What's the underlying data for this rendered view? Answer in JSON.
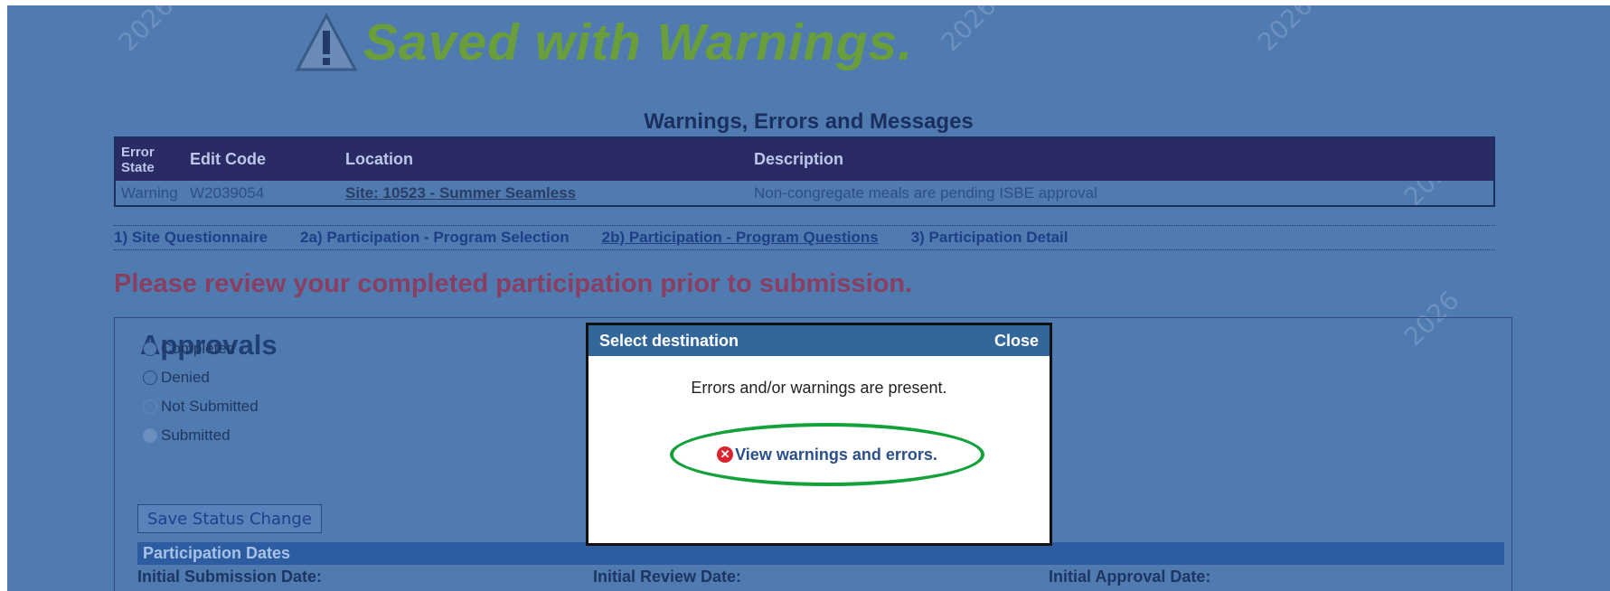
{
  "banner": {
    "text": "Saved with Warnings."
  },
  "messages": {
    "title": "Warnings, Errors and Messages",
    "columns": {
      "state": "Error State",
      "edit_code": "Edit Code",
      "location": "Location",
      "description": "Description"
    },
    "rows": [
      {
        "state": "Warning",
        "edit_code": "W2039054",
        "location": "Site: 10523 - Summer Seamless",
        "description": "Non-congregate meals are pending ISBE approval"
      }
    ]
  },
  "tabs": [
    {
      "label": "1) Site Questionnaire"
    },
    {
      "label": "2a) Participation - Program Selection"
    },
    {
      "label": "2b) Participation - Program Questions"
    },
    {
      "label": "3) Participation Detail"
    }
  ],
  "review_text": "Please review your completed participation prior to submission.",
  "approvals": {
    "title": "Approvals",
    "options": [
      {
        "label": "Completed"
      },
      {
        "label": "Denied"
      },
      {
        "label": "Not Submitted"
      },
      {
        "label": "Submitted"
      }
    ],
    "save_button": "Save Status Change"
  },
  "participation_dates": {
    "title": "Participation Dates",
    "labels": [
      "Initial Submission Date:",
      "Initial Review Date:",
      "Initial Approval Date:"
    ]
  },
  "watermark": "2026",
  "modal": {
    "title": "Select destination",
    "close": "Close",
    "message": "Errors and/or warnings are present.",
    "link": "View warnings and errors.",
    "highlight_color": "#13a13a"
  }
}
